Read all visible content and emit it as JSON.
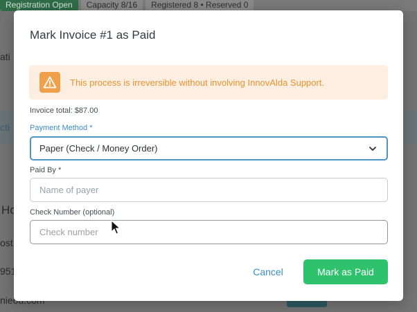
{
  "background": {
    "tags": [
      "Registration Open",
      "Capacity 8/16",
      "Registered 8 • Reserved 0"
    ],
    "fragments": {
      "f1": "ati",
      "f2": "cti",
      "f3": "Ho",
      "f4": "ost",
      "f5": "951",
      "f6": "nieou.com"
    }
  },
  "modal": {
    "title": "Mark Invoice #1 as Paid",
    "warning": {
      "icon": "warning-triangle-icon",
      "text": "This process is irreversible without involving InnovAlda Support."
    },
    "invoice_total": "Invoice total: $87.00",
    "payment_method": {
      "label": "Payment Method *",
      "value": "Paper (Check / Money Order)"
    },
    "paid_by": {
      "label": "Paid By *",
      "placeholder": "Name of payer",
      "value": ""
    },
    "check_number": {
      "label": "Check Number (optional)",
      "placeholder": "Check number",
      "value": ""
    },
    "buttons": {
      "cancel": "Cancel",
      "mark_paid": "Mark as Paid"
    }
  },
  "colors": {
    "accent": "#3a8dc2",
    "primary_button": "#2fc26d",
    "warning_bg": "#fdeee2",
    "warning_text": "#e8932e"
  }
}
